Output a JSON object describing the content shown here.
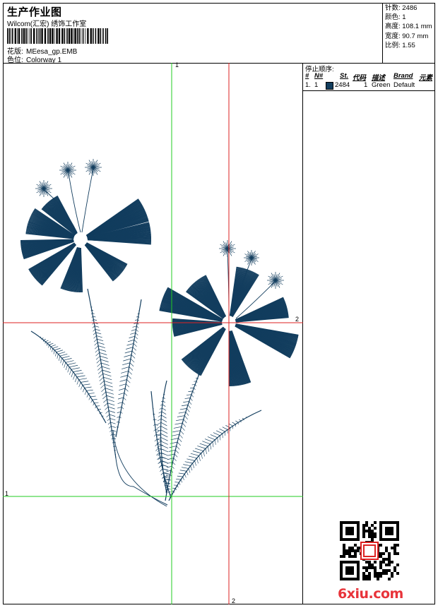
{
  "header": {
    "title": "生产作业图",
    "company": "Wilcom(汇宏) 绣饰工作室",
    "design_label": "花版:",
    "design_value": "MEesa_gp.EMB",
    "colorway_label": "色位:",
    "colorway_value": "Colorway 1"
  },
  "info": {
    "stitches": "针数: 2486",
    "colors": "颜色: 1",
    "height": "高度: 108.1 mm",
    "width": "宽度: 90.7 mm",
    "scale": "比例: 1.55"
  },
  "stop_sequence": {
    "title": "停止顺序:",
    "columns": [
      "#",
      "N#",
      "St.",
      "代码",
      "描述",
      "Brand",
      "元素"
    ],
    "rows": [
      {
        "index": "1.",
        "needle": "1",
        "stitches": "2484",
        "code": "1",
        "description": "Green",
        "brand": "Default",
        "swatch_color": "#123d5e"
      }
    ]
  },
  "axis_labels": {
    "v1": "1",
    "h2": "2",
    "h1": "1",
    "v2": "2"
  },
  "colors": {
    "thread": "#123d5e",
    "green_axis": "#22cc22",
    "red_axis": "#dd2222"
  },
  "watermark": "6xiu.com"
}
